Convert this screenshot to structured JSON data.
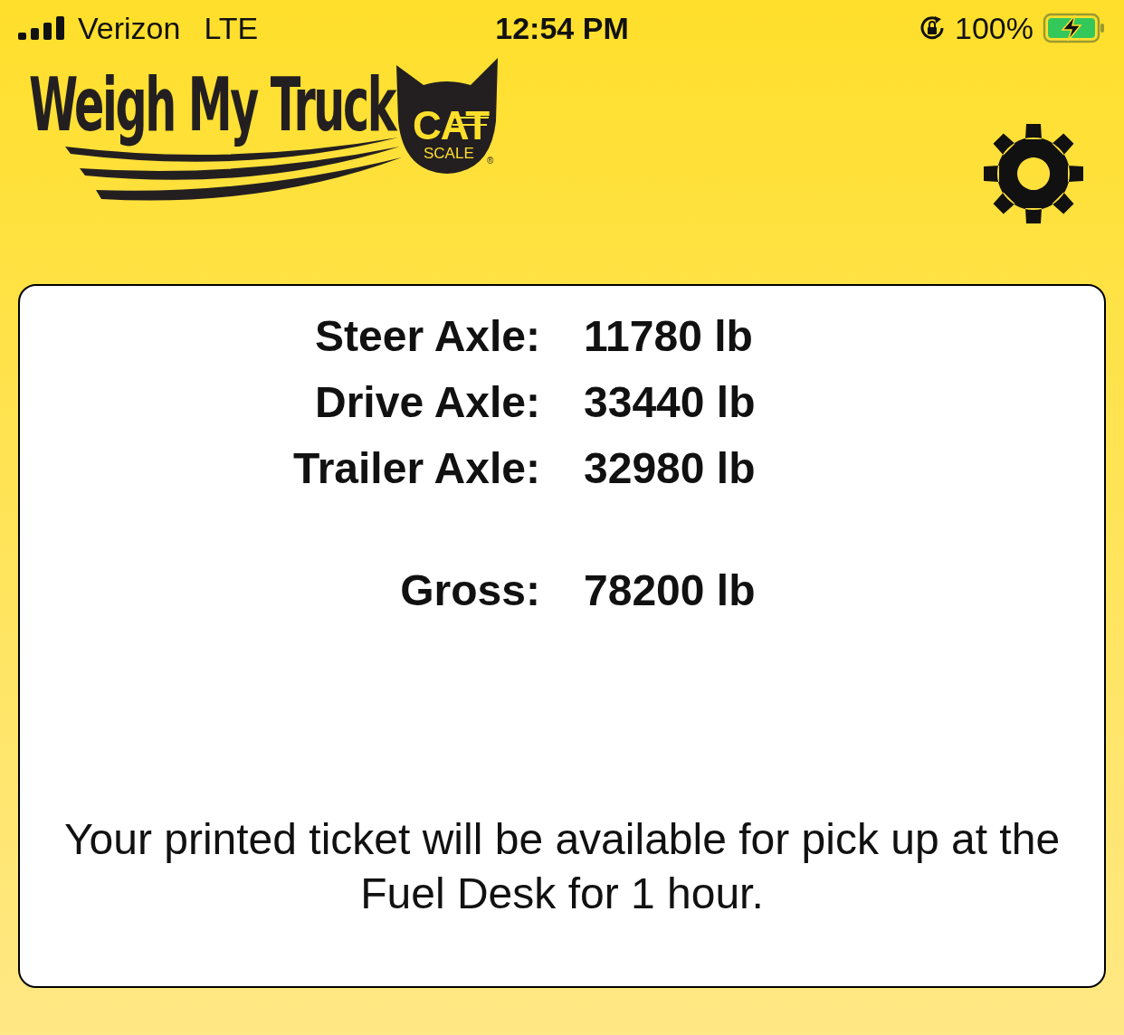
{
  "status_bar": {
    "carrier": "Verizon",
    "network": "LTE",
    "time": "12:54 PM",
    "battery": "100%"
  },
  "logo": {
    "wordmark": "Weigh My Truck",
    "badge": "CAT",
    "badge_sub": "SCALE",
    "mark": "®"
  },
  "weights": [
    {
      "kind": "axle",
      "label": "Steer Axle:",
      "value": "11780 lb"
    },
    {
      "kind": "axle",
      "label": "Drive Axle:",
      "value": "33440 lb"
    },
    {
      "kind": "axle",
      "label": "Trailer Axle:",
      "value": "32980 lb"
    },
    {
      "kind": "total",
      "label": "Gross:",
      "value": "78200 lb"
    }
  ],
  "message": "Your printed ticket will be available for pick up at the Fuel Desk for 1 hour."
}
